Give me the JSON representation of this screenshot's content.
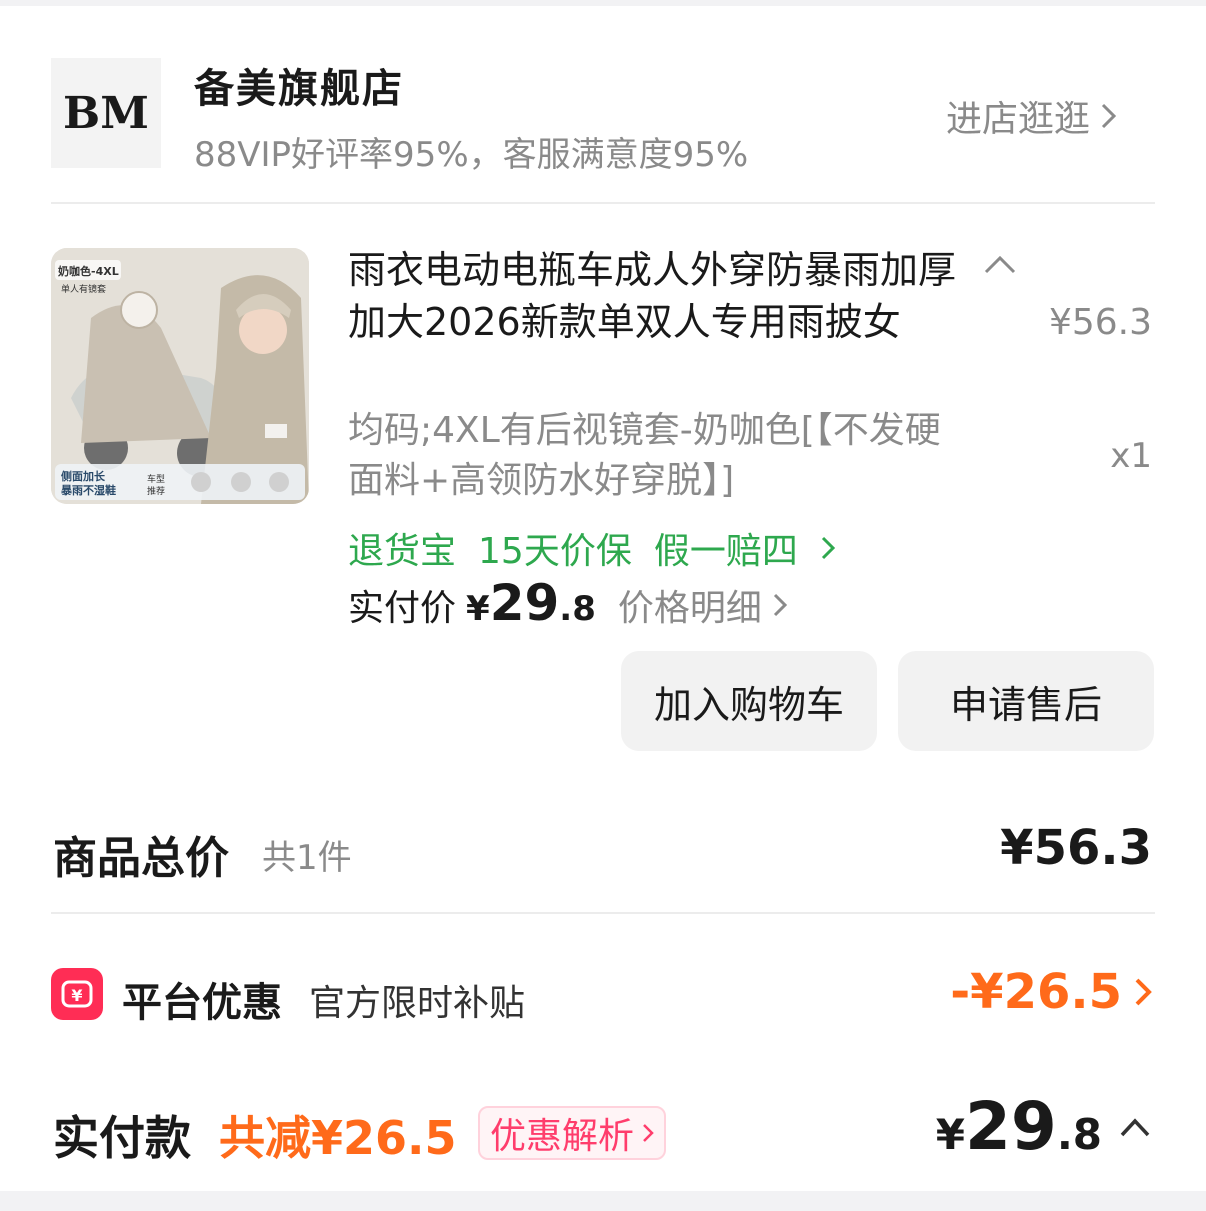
{
  "store": {
    "logo_text": "BM",
    "name": "备美旗舰店",
    "rating": "88VIP好评率95%，客服满意度95%",
    "enter_label": "进店逛逛"
  },
  "product": {
    "image_caption_top": "奶咖色-4XL",
    "image_caption_sub": "单人有镜套",
    "image_caption_bottom": "侧面加长\n暴雨不湿鞋",
    "image_caption_models": "车型推荐",
    "title": "雨衣电动电瓶车成人外穿防暴雨加厚加大2026新款单双人专用雨披女",
    "unit_price": "¥56.3",
    "spec": "均码;4XL有后视镜套-奶咖色[【不发硬面料+高领防水好穿脱】]",
    "quantity": "x1",
    "badges": [
      "退货宝",
      "15天价保",
      "假一赔四"
    ],
    "paid_label": "实付价",
    "paid_yen": "¥",
    "paid_int": "29",
    "paid_dec": ".8",
    "price_detail_label": "价格明细"
  },
  "actions": {
    "add_cart": "加入购物车",
    "after_sale": "申请售后"
  },
  "summary": {
    "total_label": "商品总价",
    "total_count": "共1件",
    "total_value": "¥56.3",
    "promo_label": "平台优惠",
    "promo_sub": "官方限时补贴",
    "promo_value": "-¥26.5",
    "final_label": "实付款",
    "final_saved": "共减¥26.5",
    "promo_analysis": "优惠解析",
    "final_yen": "¥",
    "final_int": "29",
    "final_dec": ".8"
  },
  "colors": {
    "green": "#2ea84e",
    "orange": "#ff6a1a",
    "pink": "#ff2d55",
    "grey_text": "#8a8a8a"
  }
}
